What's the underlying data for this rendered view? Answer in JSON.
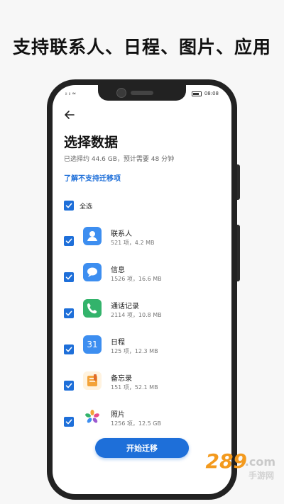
{
  "promo_title": "支持联系人、日程、图片、应用",
  "status_bar": {
    "left": "ᵢₗ ᵢₗ ≈",
    "time": "08:08"
  },
  "page": {
    "title": "选择数据",
    "subtitle": "已选择约 44.6 GB，预计需要 48 分钟",
    "link": "了解不支持迁移项",
    "select_all_label": "全选"
  },
  "items": [
    {
      "name": "联系人",
      "detail": "521 项，4.2 MB",
      "icon": "contacts-icon",
      "color": "#3d8ef0"
    },
    {
      "name": "信息",
      "detail": "1526 项，16.6 MB",
      "icon": "messages-icon",
      "color": "#3d8ef0"
    },
    {
      "name": "通话记录",
      "detail": "2114 项，10.8 MB",
      "icon": "phone-icon",
      "color": "#33b36b"
    },
    {
      "name": "日程",
      "detail": "125 项，12.3 MB",
      "icon": "calendar-icon",
      "icon_text": "31",
      "color": "#3d8ef0"
    },
    {
      "name": "备忘录",
      "detail": "151 项，52.1 MB",
      "icon": "notes-icon",
      "color": "#f3a33a"
    },
    {
      "name": "照片",
      "detail": "1256 项，12.5 GB",
      "icon": "photos-icon",
      "color": "#e94b8a"
    }
  ],
  "start_button": "开始迁移",
  "watermark": {
    "number": "289",
    "domain": ".com",
    "name": "手游网"
  }
}
